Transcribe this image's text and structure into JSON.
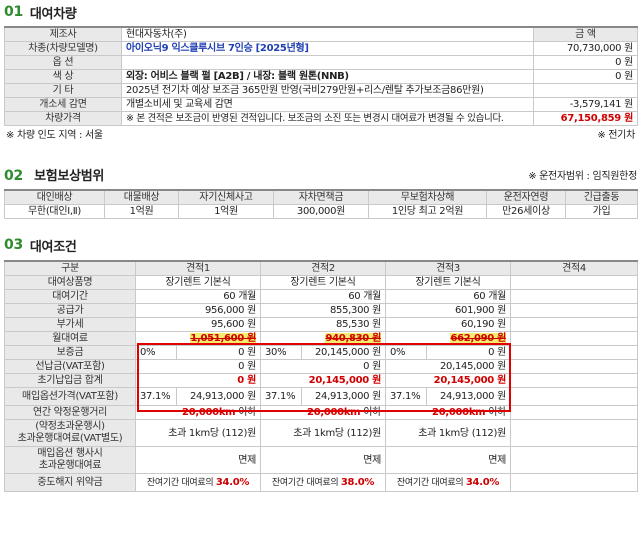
{
  "section1": {
    "num": "01",
    "title": "대여차량",
    "maker_label": "제조사",
    "maker_value": "현대자동차(주)",
    "amount_header": "금 액",
    "model_label": "차종(차량모델명)",
    "model_value": "아이오닉9 익스클루시브 7인승 [2025년형]",
    "model_amount": "70,730,000 원",
    "option_label": "옵 션",
    "option_amount": "0 원",
    "color_label": "색 상",
    "color_value": "외장: 어비스 블랙 펄 [A2B] / 내장: 블랙 원톤(NNB)",
    "color_amount": "0 원",
    "etc_label": "기 타",
    "etc_value": "2025년 전기차 예상 보조금 365만원 반영(국비279만원+리스/렌탈 추가보조금86만원)",
    "tax_label": "개소세 감면",
    "tax_value": "개별소비세 및 교육세 감면",
    "tax_amount": "-3,579,141 원",
    "price_label": "차량가격",
    "price_note": "※ 본 견적은 보조금이 반영된 견적입니다. 보조금의 소진 또는 변경시 대여료가 변경될 수 있습니다.",
    "price_amount": "67,150,859 원",
    "delivery_note": "※ 차량 인도 지역 : 서울",
    "ev_note": "※ 전기차"
  },
  "section2": {
    "num": "02",
    "title": "보험보상범위",
    "driver_note": "※ 운전자범위 : 임직원한정",
    "headers": [
      "대인배상",
      "대물배상",
      "자기신체사고",
      "자차면책금",
      "무보험차상해",
      "운전자연령",
      "긴급출동"
    ],
    "values": [
      "무한(대인Ⅰ,Ⅱ)",
      "1억원",
      "1억원",
      "300,000원",
      "1인당 최고 2억원",
      "만26세이상",
      "가입"
    ]
  },
  "section3": {
    "num": "03",
    "title": "대여조건",
    "header": [
      "구분",
      "견적1",
      "견적2",
      "견적3",
      "견적4"
    ],
    "product_label": "대여상품명",
    "product": [
      "장기렌트 기본식",
      "장기렌트 기본식",
      "장기렌트 기본식"
    ],
    "period_label": "대여기간",
    "period": [
      "60 개월",
      "60 개월",
      "60 개월"
    ],
    "supply_label": "공급가",
    "supply": [
      "956,000 원",
      "855,300 원",
      "601,900 원"
    ],
    "vat_label": "부가세",
    "vat": [
      "95,600 원",
      "85,530 원",
      "60,190 원"
    ],
    "monthly_label": "월대여료",
    "monthly": [
      "1,051,600 원",
      "940,830 원",
      "662,090 원"
    ],
    "deposit_label": "보증금",
    "deposit_pct": [
      "0%",
      "30%",
      "0%"
    ],
    "deposit": [
      "0 원",
      "20,145,000 원",
      "0 원"
    ],
    "prepay_label": "선납금(VAT포함)",
    "prepay": [
      "0 원",
      "0 원",
      "20,145,000 원"
    ],
    "initial_label": "초기납입금 합계",
    "initial": [
      "0 원",
      "20,145,000 원",
      "20,145,000 원"
    ],
    "purchase_label": "매입옵션가격(VAT포함)",
    "purchase_pct": [
      "37.1%",
      "37.1%",
      "37.1%"
    ],
    "purchase": [
      "24,913,000 원",
      "24,913,000 원",
      "24,913,000 원"
    ],
    "mileage_label": "연간 약정운행거리",
    "mileage": [
      "20,000km",
      "20,000km",
      "20,000km"
    ],
    "mileage_suffix": "이하",
    "excess_label1": "(약정초과운행시)",
    "excess_label2": "초과운행대여료(VAT별도)",
    "excess": [
      "초과 1km당 (112)원",
      "초과 1km당 (112)원",
      "초과 1km당 (112)원"
    ],
    "exercise_label1": "매입옵션 행사시",
    "exercise_label2": "초과운행대여료",
    "exercise": [
      "면제",
      "면제",
      "면제"
    ],
    "penalty_label": "중도해지 위약금",
    "penalty_prefix": "잔여기간 대여료의",
    "penalty": [
      "34.0%",
      "38.0%",
      "34.0%"
    ]
  }
}
